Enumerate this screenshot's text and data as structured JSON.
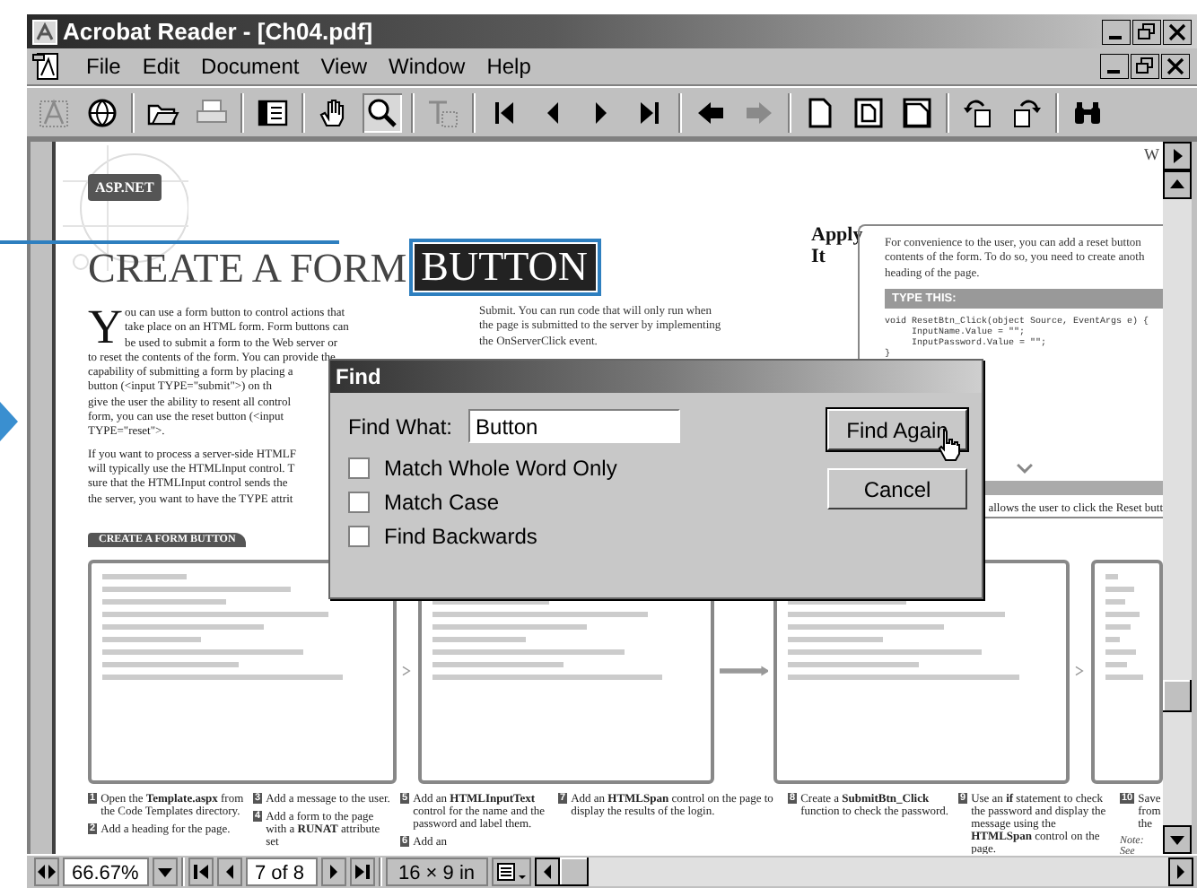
{
  "window": {
    "title": "Acrobat Reader - [Ch04.pdf]"
  },
  "menu": [
    "File",
    "Edit",
    "Document",
    "View",
    "Window",
    "Help"
  ],
  "toolbar": [
    {
      "kind": "text-select",
      "disabled": true,
      "selected": false
    },
    {
      "kind": "web",
      "disabled": false,
      "selected": false
    },
    {
      "kind": "sep"
    },
    {
      "kind": "open",
      "disabled": false,
      "selected": false
    },
    {
      "kind": "print",
      "disabled": true,
      "selected": false
    },
    {
      "kind": "sep"
    },
    {
      "kind": "panel",
      "disabled": false,
      "selected": false
    },
    {
      "kind": "sep"
    },
    {
      "kind": "hand",
      "disabled": false,
      "selected": false
    },
    {
      "kind": "zoom",
      "disabled": false,
      "selected": true
    },
    {
      "kind": "sep"
    },
    {
      "kind": "text-tool",
      "disabled": true,
      "selected": false
    },
    {
      "kind": "sep"
    },
    {
      "kind": "first",
      "disabled": false,
      "selected": false
    },
    {
      "kind": "prev",
      "disabled": false,
      "selected": false
    },
    {
      "kind": "next",
      "disabled": false,
      "selected": false
    },
    {
      "kind": "last",
      "disabled": false,
      "selected": false
    },
    {
      "kind": "sep"
    },
    {
      "kind": "back",
      "disabled": false,
      "selected": false
    },
    {
      "kind": "forward",
      "disabled": true,
      "selected": false
    },
    {
      "kind": "sep"
    },
    {
      "kind": "page",
      "disabled": false,
      "selected": false
    },
    {
      "kind": "fit-page",
      "disabled": false,
      "selected": false
    },
    {
      "kind": "fit-width",
      "disabled": false,
      "selected": false
    },
    {
      "kind": "sep"
    },
    {
      "kind": "rotate-left",
      "disabled": false,
      "selected": false
    },
    {
      "kind": "rotate-right",
      "disabled": false,
      "selected": false
    },
    {
      "kind": "sep"
    },
    {
      "kind": "find",
      "disabled": false,
      "selected": false
    }
  ],
  "document": {
    "section_tag": "ASP.NET",
    "heading": "CREATE A FORM",
    "heading_match": "BUTTON",
    "corner_text": "W",
    "drop_cap": "Y",
    "intro_lines": [
      "ou can use a form button to control actions that",
      "take place on an HTML form.  Form buttons can",
      "be used to submit a form to the Web server or",
      "to reset the contents of the form. You can provide the",
      "capability of submitting a form by placing a",
      "button (<input TYPE=\"submit\">) on th",
      "give the user the ability to resent all control",
      "form, you can use the reset button (<input",
      "TYPE=\"reset\">."
    ],
    "para2_lines": [
      "If you want to process a server-side HTMLF",
      "will typically use the HTMLInput control. T",
      "sure that the HTMLInput control sends the",
      "the server, you want to have the TYPE attrit"
    ],
    "col2_lines": [
      "Submit. You can run code that will only run when",
      "the page is submitted to the server by implementing",
      "the OnServerClick event."
    ],
    "apply_it": {
      "title": "Apply It",
      "text_lines": [
        "For convenience to the user, you can add a reset button",
        "contents of the form. To do so, you need to create anoth",
        "heading of the page."
      ],
      "type_this": "TYPE THIS:",
      "code_lines": [
        "void ResetBtn_Click(object Source, EventArgs e) {",
        "     InputName.Value = \"\";",
        "     InputPassword.Value = \"\";",
        "}"
      ],
      "result_line": "allows the user to click the Reset butt"
    },
    "figure_title": "CREATE A FORM BUTTON",
    "step_columns": [
      [
        {
          "number": "1",
          "text": "Open the **Template.aspx** from the Code Templates directory."
        },
        {
          "number": "2",
          "text": "Add a heading for the page."
        }
      ],
      [
        {
          "number": "3",
          "text": "Add a message to the user."
        },
        {
          "number": "4",
          "text": "Add a form to the page with a **RUNAT** attribute set"
        }
      ],
      [
        {
          "number": "5",
          "text": "Add an **HTMLInputText** control for the name and the password and label them."
        },
        {
          "number": "6",
          "text": "Add an"
        }
      ],
      [
        {
          "number": "7",
          "text": "Add an **HTMLSpan** control on the page to display the results of the login."
        }
      ],
      [
        {
          "number": "8",
          "text": "Create a **SubmitBtn_Click** function to check the password."
        }
      ],
      [
        {
          "number": "9",
          "text": "Use an **if** statement to check the password and display the message using the **HTMLSpan** control on the page."
        }
      ],
      [
        {
          "number": "10",
          "text": "Save from the"
        }
      ]
    ],
    "note": "Note: See"
  },
  "find_dialog": {
    "title": "Find",
    "find_what_label": "Find What:",
    "value": "Button",
    "options": [
      {
        "label": "Match Whole Word Only",
        "checked": false
      },
      {
        "label": "Match Case",
        "checked": false
      },
      {
        "label": "Find Backwards",
        "checked": false
      }
    ],
    "buttons": [
      {
        "label": "Find Again",
        "default": true
      },
      {
        "label": "Cancel",
        "default": false
      }
    ]
  },
  "status_bar": {
    "zoom": "66.67%",
    "page": "7 of 8",
    "page_size": "16 × 9 in"
  }
}
